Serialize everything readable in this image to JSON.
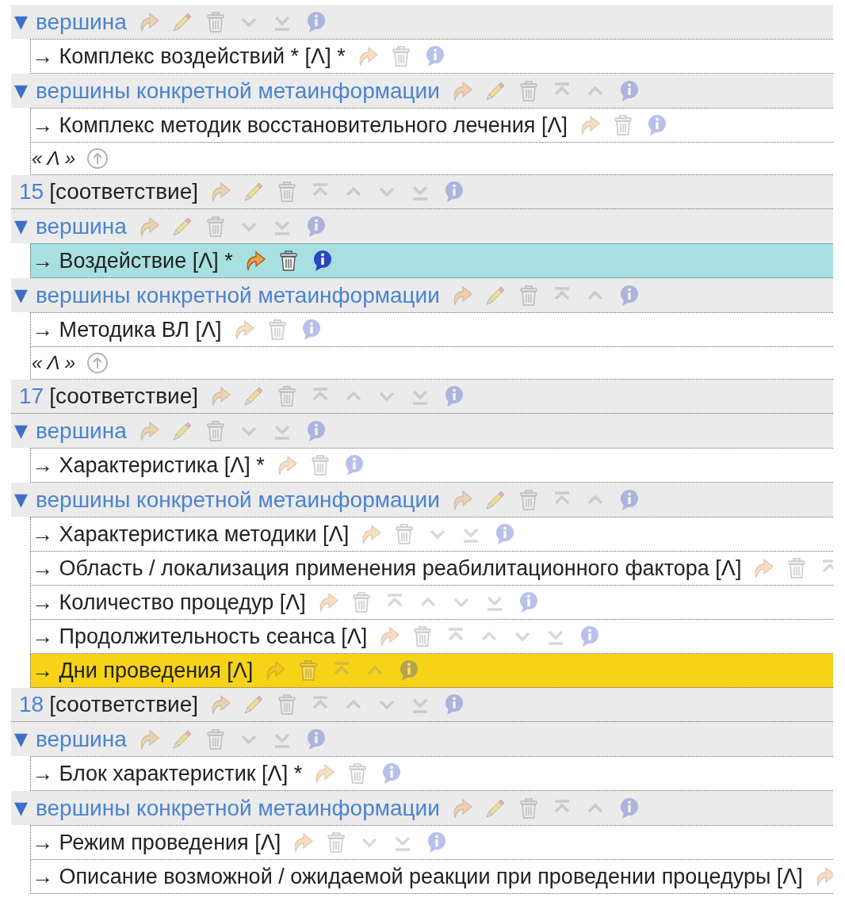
{
  "tree": [
    {
      "kind": "group",
      "toggle": "▼",
      "label": "вершина",
      "actions": [
        {
          "kind": "reply"
        },
        {
          "kind": "edit"
        },
        {
          "kind": "delete"
        },
        {
          "kind": "down"
        },
        {
          "kind": "bottom"
        },
        {
          "kind": "info"
        }
      ],
      "children": [
        {
          "label": "→ Комплекс воздействий * [Λ] *",
          "selected": false,
          "marked": false,
          "actions": [
            {
              "kind": "reply"
            },
            {
              "kind": "delete"
            },
            {
              "kind": "info"
            }
          ]
        }
      ]
    },
    {
      "kind": "group",
      "toggle": "▼",
      "label": "вершины конкретной метаинформации",
      "actions": [
        {
          "kind": "reply"
        },
        {
          "kind": "edit"
        },
        {
          "kind": "delete"
        },
        {
          "kind": "top"
        },
        {
          "kind": "up"
        },
        {
          "kind": "info"
        }
      ],
      "children": [
        {
          "label": "→ Комплекс методик восстановительного лечения [Λ]",
          "selected": false,
          "marked": false,
          "actions": [
            {
              "kind": "reply"
            },
            {
              "kind": "delete"
            },
            {
              "kind": "info"
            }
          ]
        }
      ]
    },
    {
      "kind": "nav",
      "label": "« Λ »",
      "actions": [
        {
          "kind": "up-circle"
        }
      ]
    },
    {
      "kind": "match",
      "number": "15",
      "label": "[соответствие]",
      "actions": [
        {
          "kind": "reply"
        },
        {
          "kind": "edit"
        },
        {
          "kind": "delete"
        },
        {
          "kind": "top"
        },
        {
          "kind": "up"
        },
        {
          "kind": "down"
        },
        {
          "kind": "bottom"
        },
        {
          "kind": "info"
        }
      ]
    },
    {
      "kind": "group",
      "toggle": "▼",
      "label": "вершина",
      "actions": [
        {
          "kind": "reply"
        },
        {
          "kind": "edit"
        },
        {
          "kind": "delete"
        },
        {
          "kind": "down"
        },
        {
          "kind": "bottom"
        },
        {
          "kind": "info"
        }
      ],
      "children": [
        {
          "label": "→ Воздействие [Λ] *",
          "selected": true,
          "marked": false,
          "actions": [
            {
              "kind": "reply"
            },
            {
              "kind": "delete"
            },
            {
              "kind": "info"
            }
          ]
        }
      ]
    },
    {
      "kind": "group",
      "toggle": "▼",
      "label": "вершины конкретной метаинформации",
      "actions": [
        {
          "kind": "reply"
        },
        {
          "kind": "edit"
        },
        {
          "kind": "delete"
        },
        {
          "kind": "top"
        },
        {
          "kind": "up"
        },
        {
          "kind": "info"
        }
      ],
      "children": [
        {
          "label": "→ Методика ВЛ [Λ]",
          "selected": false,
          "marked": false,
          "actions": [
            {
              "kind": "reply"
            },
            {
              "kind": "delete"
            },
            {
              "kind": "info"
            }
          ]
        }
      ]
    },
    {
      "kind": "nav",
      "label": "« Λ »",
      "actions": [
        {
          "kind": "up-circle"
        }
      ]
    },
    {
      "kind": "match",
      "number": "17",
      "label": "[соответствие]",
      "actions": [
        {
          "kind": "reply"
        },
        {
          "kind": "edit"
        },
        {
          "kind": "delete"
        },
        {
          "kind": "top"
        },
        {
          "kind": "up"
        },
        {
          "kind": "down"
        },
        {
          "kind": "bottom"
        },
        {
          "kind": "info"
        }
      ]
    },
    {
      "kind": "group",
      "toggle": "▼",
      "label": "вершина",
      "actions": [
        {
          "kind": "reply"
        },
        {
          "kind": "edit"
        },
        {
          "kind": "delete"
        },
        {
          "kind": "down"
        },
        {
          "kind": "bottom"
        },
        {
          "kind": "info"
        }
      ],
      "children": [
        {
          "label": "→ Характеристика [Λ] *",
          "selected": false,
          "marked": false,
          "actions": [
            {
              "kind": "reply"
            },
            {
              "kind": "delete"
            },
            {
              "kind": "info"
            }
          ]
        }
      ]
    },
    {
      "kind": "group",
      "toggle": "▼",
      "label": "вершины конкретной метаинформации",
      "actions": [
        {
          "kind": "reply"
        },
        {
          "kind": "edit"
        },
        {
          "kind": "delete"
        },
        {
          "kind": "top"
        },
        {
          "kind": "up"
        },
        {
          "kind": "info"
        }
      ],
      "children": [
        {
          "label": "→ Характеристика методики [Λ]",
          "selected": false,
          "marked": false,
          "actions": [
            {
              "kind": "reply"
            },
            {
              "kind": "delete"
            },
            {
              "kind": "down"
            },
            {
              "kind": "bottom"
            },
            {
              "kind": "info"
            }
          ]
        },
        {
          "label": "→ Область / локализация применения реабилитационного фактора [Λ]",
          "selected": false,
          "marked": false,
          "actions": [
            {
              "kind": "reply"
            },
            {
              "kind": "delete"
            },
            {
              "kind": "top"
            }
          ]
        },
        {
          "label": "→ Количество процедур [Λ]",
          "selected": false,
          "marked": false,
          "actions": [
            {
              "kind": "reply"
            },
            {
              "kind": "delete"
            },
            {
              "kind": "top"
            },
            {
              "kind": "up"
            },
            {
              "kind": "down"
            },
            {
              "kind": "bottom"
            },
            {
              "kind": "info"
            }
          ]
        },
        {
          "label": "→ Продолжительность сеанса [Λ]",
          "selected": false,
          "marked": false,
          "actions": [
            {
              "kind": "reply"
            },
            {
              "kind": "delete"
            },
            {
              "kind": "top"
            },
            {
              "kind": "up"
            },
            {
              "kind": "down"
            },
            {
              "kind": "bottom"
            },
            {
              "kind": "info"
            }
          ]
        },
        {
          "label": "→ Дни проведения [Λ]",
          "selected": false,
          "marked": true,
          "actions": [
            {
              "kind": "reply"
            },
            {
              "kind": "delete"
            },
            {
              "kind": "top"
            },
            {
              "kind": "up"
            },
            {
              "kind": "info"
            }
          ]
        }
      ]
    },
    {
      "kind": "match",
      "number": "18",
      "label": "[соответствие]",
      "actions": [
        {
          "kind": "reply"
        },
        {
          "kind": "edit"
        },
        {
          "kind": "delete"
        },
        {
          "kind": "top"
        },
        {
          "kind": "up"
        },
        {
          "kind": "down"
        },
        {
          "kind": "bottom"
        },
        {
          "kind": "info"
        }
      ]
    },
    {
      "kind": "group",
      "toggle": "▼",
      "label": "вершина",
      "actions": [
        {
          "kind": "reply"
        },
        {
          "kind": "edit"
        },
        {
          "kind": "delete"
        },
        {
          "kind": "down"
        },
        {
          "kind": "bottom"
        },
        {
          "kind": "info"
        }
      ],
      "children": [
        {
          "label": "→ Блок характеристик [Λ] *",
          "selected": false,
          "marked": false,
          "actions": [
            {
              "kind": "reply"
            },
            {
              "kind": "delete"
            },
            {
              "kind": "info"
            }
          ]
        }
      ]
    },
    {
      "kind": "group",
      "toggle": "▼",
      "label": "вершины конкретной метаинформации",
      "actions": [
        {
          "kind": "reply"
        },
        {
          "kind": "edit"
        },
        {
          "kind": "delete"
        },
        {
          "kind": "top"
        },
        {
          "kind": "up"
        },
        {
          "kind": "info"
        }
      ],
      "children": [
        {
          "label": "→ Режим проведения [Λ]",
          "selected": false,
          "marked": false,
          "actions": [
            {
              "kind": "reply"
            },
            {
              "kind": "delete"
            },
            {
              "kind": "down"
            },
            {
              "kind": "bottom"
            },
            {
              "kind": "info"
            }
          ]
        },
        {
          "label": "→ Описание возможной / ожидаемой реакции при проведении процедуры [Λ]",
          "selected": false,
          "marked": false,
          "actions": [
            {
              "kind": "reply"
            }
          ]
        }
      ]
    }
  ]
}
